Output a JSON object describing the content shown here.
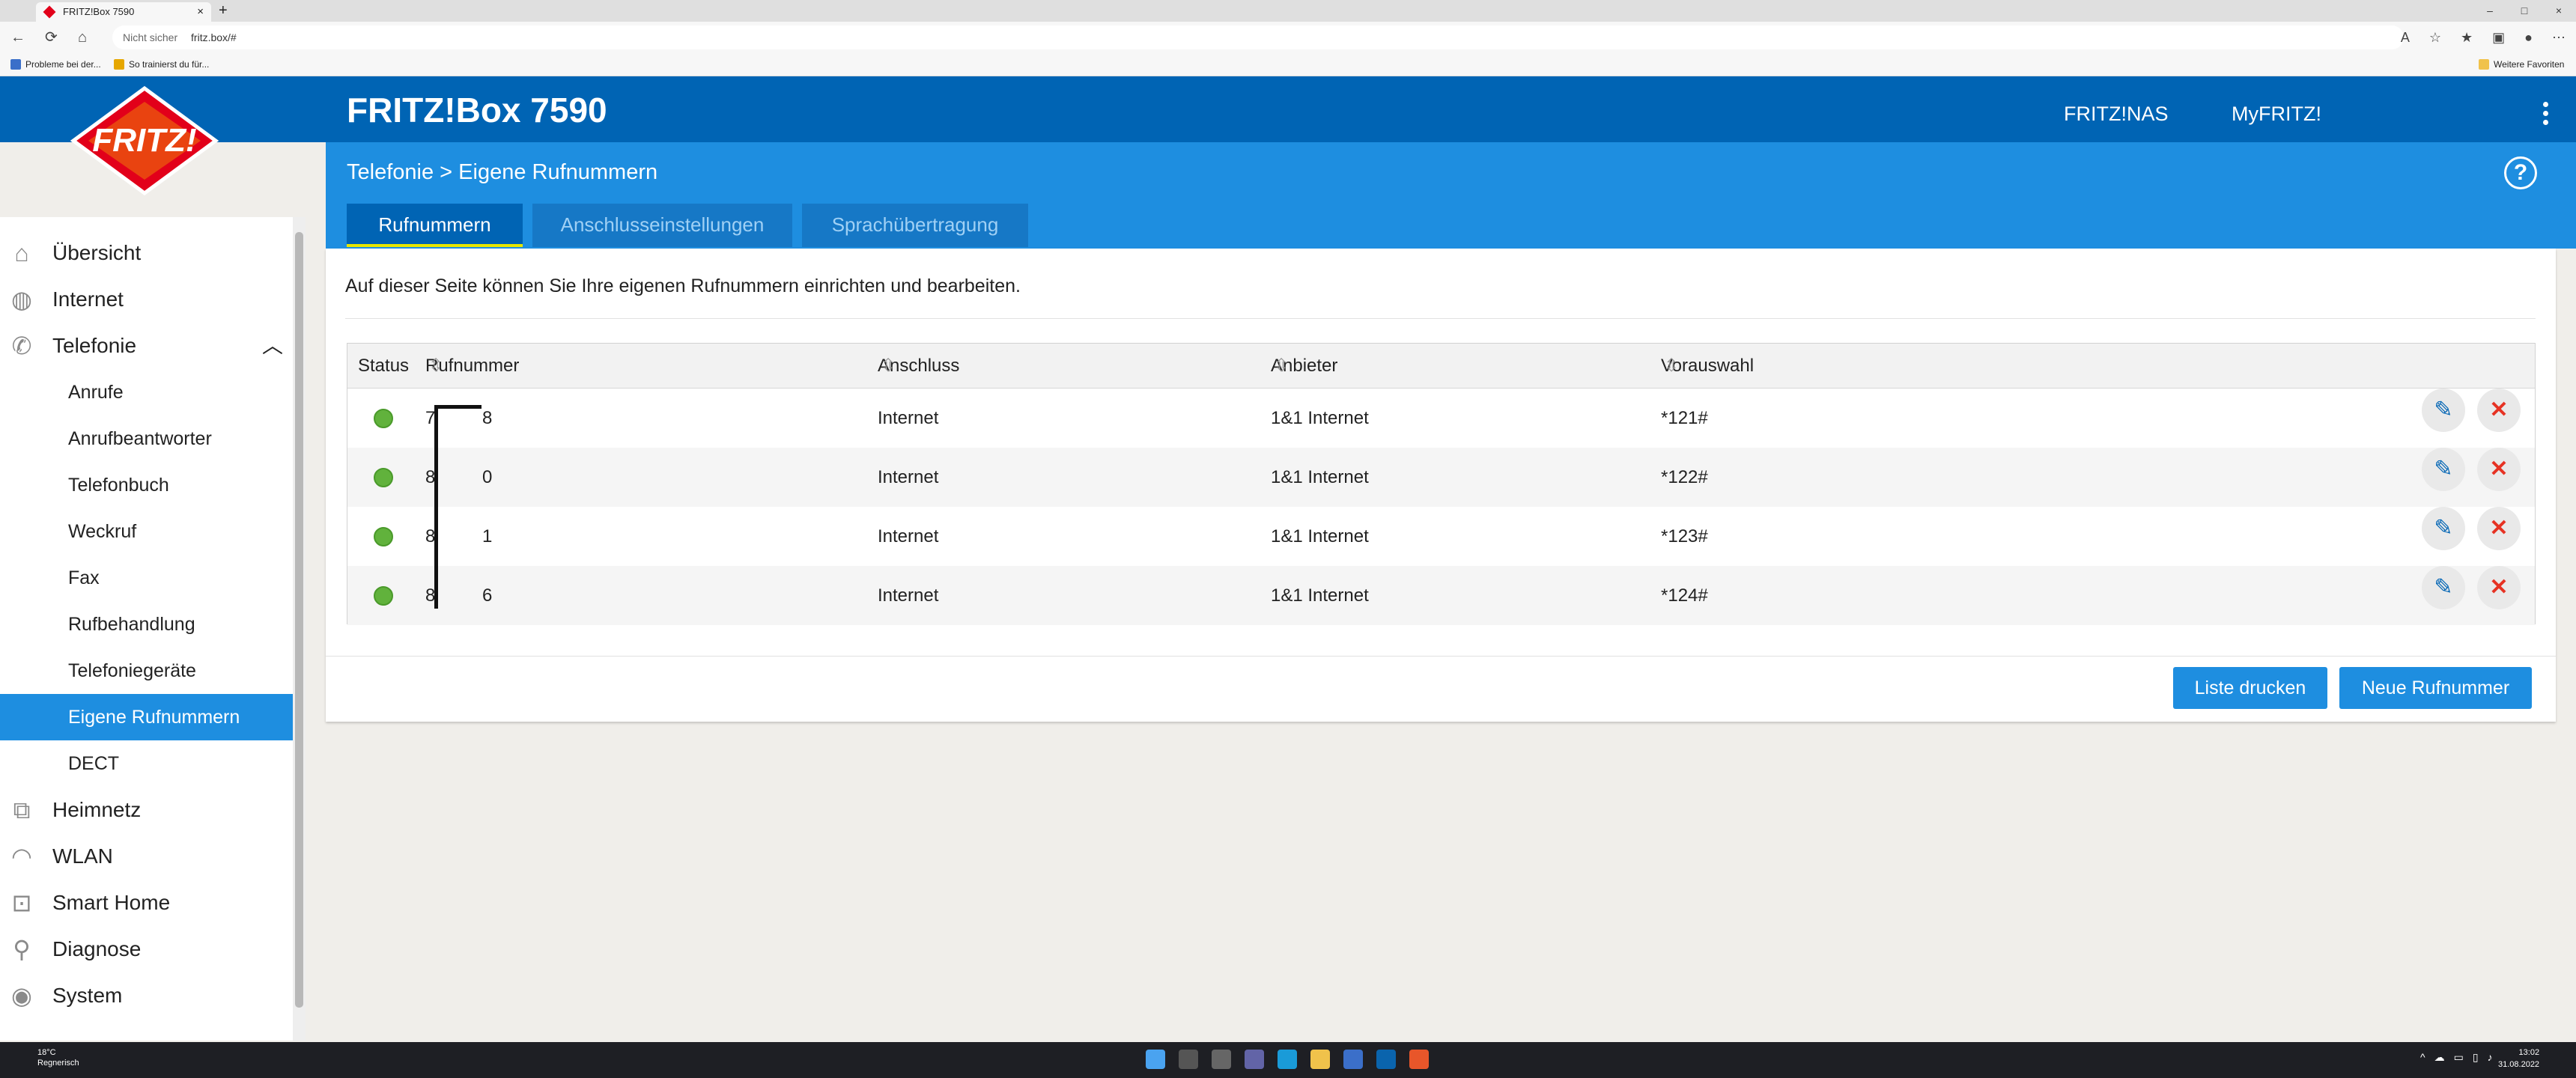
{
  "browser": {
    "tab_title": "FRITZ!Box 7590",
    "security": "Nicht sicher",
    "url": "fritz.box/#",
    "favorites": [
      "Probleme bei der...",
      "So trainierst du für..."
    ],
    "other_favorites": "Weitere Favoriten"
  },
  "header": {
    "title": "FRITZ!Box 7590",
    "links": [
      "FRITZ!NAS",
      "MyFRITZ!"
    ],
    "logo_text": "FRITZ!"
  },
  "breadcrumb": {
    "parent": "Telefonie",
    "sep": ">",
    "current": "Eigene Rufnummern"
  },
  "help": "?",
  "tabs": [
    {
      "label": "Rufnummern",
      "active": true
    },
    {
      "label": "Anschlusseinstellungen",
      "active": false
    },
    {
      "label": "Sprachübertragung",
      "active": false
    }
  ],
  "sidebar": {
    "main": [
      {
        "label": "Übersicht",
        "icon": "home-icon"
      },
      {
        "label": "Internet",
        "icon": "globe-icon"
      },
      {
        "label": "Telefonie",
        "icon": "phone-icon",
        "expanded": true
      },
      {
        "label": "Heimnetz",
        "icon": "network-icon"
      },
      {
        "label": "WLAN",
        "icon": "wifi-icon"
      },
      {
        "label": "Smart Home",
        "icon": "smarthome-icon"
      },
      {
        "label": "Diagnose",
        "icon": "diagnose-icon"
      },
      {
        "label": "System",
        "icon": "system-icon"
      }
    ],
    "sub": [
      "Anrufe",
      "Anrufbeantworter",
      "Telefonbuch",
      "Weckruf",
      "Fax",
      "Rufbehandlung",
      "Telefoniegeräte",
      "Eigene Rufnummern",
      "DECT"
    ],
    "active_sub": "Eigene Rufnummern"
  },
  "content": {
    "intro": "Auf dieser Seite können Sie Ihre eigenen Rufnummern einrichten und bearbeiten.",
    "columns": [
      "Status",
      "Rufnummer",
      "Anschluss",
      "Anbieter",
      "Vorauswahl"
    ],
    "rows": [
      {
        "nr_start": "7",
        "nr_end": "8",
        "anschluss": "Internet",
        "anbieter": "1&1 Internet",
        "vorauswahl": "*121#"
      },
      {
        "nr_start": "8",
        "nr_end": "0",
        "anschluss": "Internet",
        "anbieter": "1&1 Internet",
        "vorauswahl": "*122#"
      },
      {
        "nr_start": "8",
        "nr_end": "1",
        "anschluss": "Internet",
        "anbieter": "1&1 Internet",
        "vorauswahl": "*123#"
      },
      {
        "nr_start": "8",
        "nr_end": "6",
        "anschluss": "Internet",
        "anbieter": "1&1 Internet",
        "vorauswahl": "*124#"
      }
    ],
    "print_button": "Liste drucken",
    "new_button": "Neue Rufnummer"
  },
  "taskbar": {
    "weather_temp": "18°C",
    "weather_desc": "Regnerisch",
    "time": "13:02",
    "date": "31.08.2022"
  },
  "colors": {
    "fritz_blue": "#0064b4",
    "accent_blue": "#1e8ee0",
    "status_green": "#61b23c",
    "delete_red": "#e63223"
  }
}
